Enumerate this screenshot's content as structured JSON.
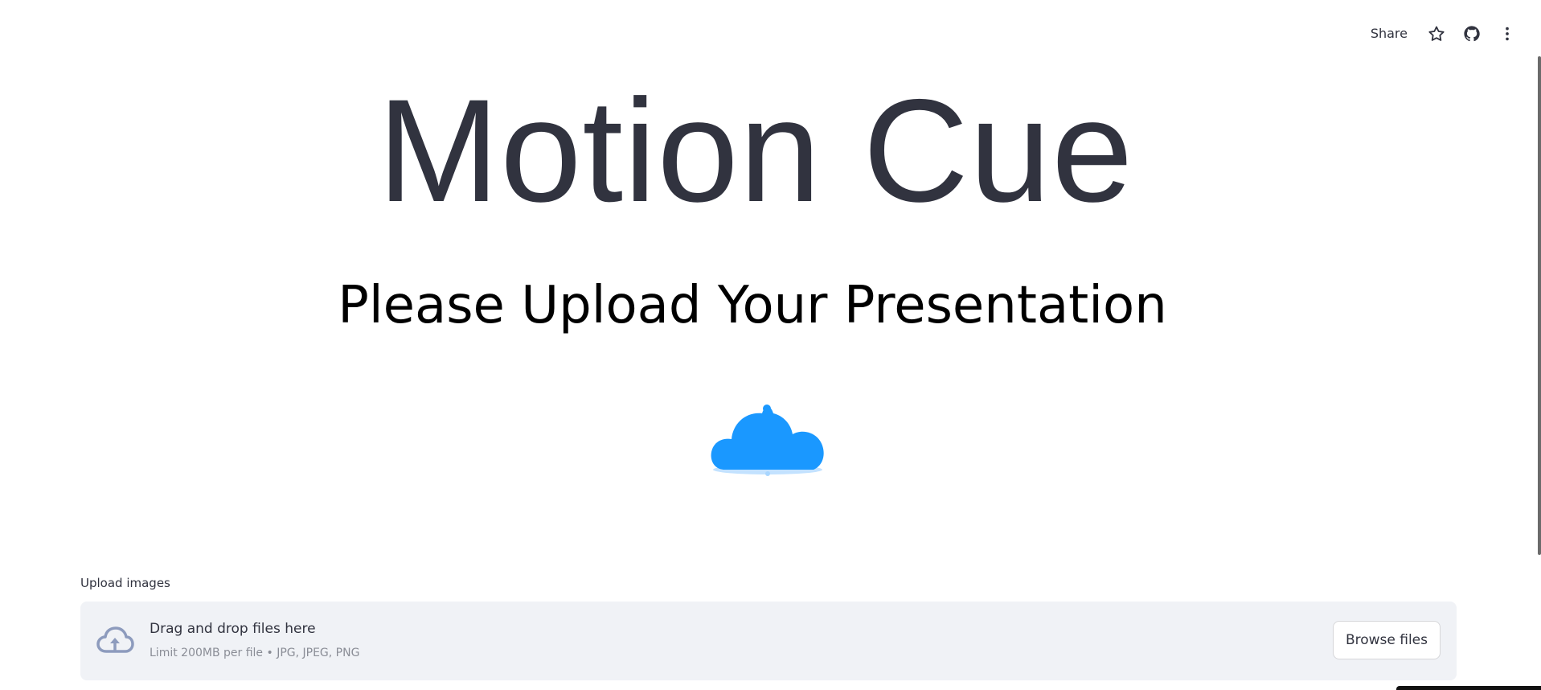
{
  "header": {
    "share_label": "Share",
    "icons": [
      "star-icon",
      "github-icon",
      "more-vertical-icon"
    ]
  },
  "main": {
    "title": "Motion Cue",
    "subtitle": "Please Upload Your Presentation",
    "animation_icon": "cloud-icon"
  },
  "uploader": {
    "label": "Upload images",
    "drop_text": "Drag and drop files here",
    "limit_text": "Limit 200MB per file • JPG, JPEG, PNG",
    "browse_label": "Browse files",
    "icon": "cloud-upload-icon"
  },
  "colors": {
    "text": "#31333f",
    "cloud": "#1a98ff",
    "dropzone_bg": "#f0f2f6",
    "muted": "#8a8d96"
  }
}
